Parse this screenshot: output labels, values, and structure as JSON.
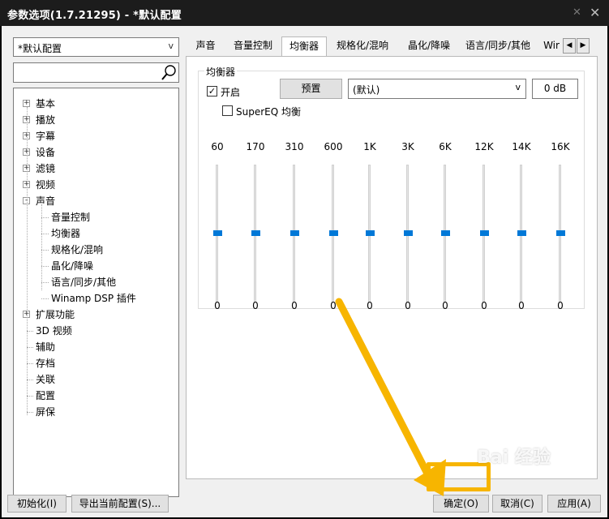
{
  "window": {
    "title": "参数选项(1.7.21295) - *默认配置"
  },
  "profile": {
    "selected": "*默认配置"
  },
  "tree": {
    "items": [
      {
        "label": "基本",
        "expander": "+"
      },
      {
        "label": "播放",
        "expander": "+"
      },
      {
        "label": "字幕",
        "expander": "+"
      },
      {
        "label": "设备",
        "expander": "+"
      },
      {
        "label": "滤镜",
        "expander": "+"
      },
      {
        "label": "视频",
        "expander": "+"
      },
      {
        "label": "声音",
        "expander": "−"
      },
      {
        "label": "音量控制",
        "child": true
      },
      {
        "label": "均衡器",
        "child": true,
        "selected": true
      },
      {
        "label": "规格化/混响",
        "child": true
      },
      {
        "label": "晶化/降噪",
        "child": true
      },
      {
        "label": "语言/同步/其他",
        "child": true
      },
      {
        "label": "Winamp DSP 插件",
        "child": true
      },
      {
        "label": "扩展功能",
        "expander": "+"
      },
      {
        "label": "3D 视频"
      },
      {
        "label": "辅助"
      },
      {
        "label": "存档"
      },
      {
        "label": "关联"
      },
      {
        "label": "配置"
      },
      {
        "label": "屏保"
      }
    ]
  },
  "tabs": [
    {
      "label": "声音"
    },
    {
      "label": "音量控制"
    },
    {
      "label": "均衡器",
      "active": true
    },
    {
      "label": "规格化/混响"
    },
    {
      "label": "晶化/降噪"
    },
    {
      "label": "语言/同步/其他"
    },
    {
      "label": "Wir"
    }
  ],
  "equalizer": {
    "group_title": "均衡器",
    "enable_label": "开启",
    "enable_checked": true,
    "preset_button": "预置",
    "preset_selected": "(默认)",
    "db_value": "0 dB",
    "supereq_label": "SuperEQ 均衡",
    "supereq_checked": false,
    "bands": [
      {
        "freq": "60",
        "gain": "0"
      },
      {
        "freq": "170",
        "gain": "0"
      },
      {
        "freq": "310",
        "gain": "0"
      },
      {
        "freq": "600",
        "gain": "0"
      },
      {
        "freq": "1K",
        "gain": "0"
      },
      {
        "freq": "3K",
        "gain": "0"
      },
      {
        "freq": "6K",
        "gain": "0"
      },
      {
        "freq": "12K",
        "gain": "0"
      },
      {
        "freq": "14K",
        "gain": "0"
      },
      {
        "freq": "16K",
        "gain": "0"
      }
    ]
  },
  "buttons": {
    "init": "初始化(I)",
    "export": "导出当前配置(S)...",
    "ok": "确定(O)",
    "cancel": "取消(C)",
    "apply": "应用(A)"
  },
  "watermark": "Bai 经验",
  "colors": {
    "highlight": "#f7b500",
    "slider_thumb": "#0078d7",
    "titlebar": "#1c1c1c"
  },
  "icons": {
    "pin": "pin-icon",
    "close": "close-icon",
    "search": "search-icon"
  }
}
